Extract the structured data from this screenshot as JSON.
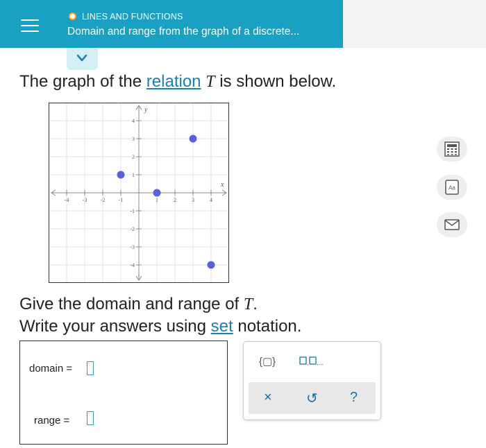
{
  "header": {
    "topic": "LINES AND FUNCTIONS",
    "subtitle": "Domain and range from the graph of a discrete...",
    "menu_icon": "hamburger-menu-icon",
    "expand_icon": "chevron-down-icon"
  },
  "prompt": {
    "before": "The graph of the ",
    "link": "relation",
    "var": "T",
    "after": " is shown below."
  },
  "graph": {
    "x_label": "x",
    "y_label": "y",
    "x_ticks": [
      "-4",
      "-3",
      "-2",
      "-1",
      "1",
      "2",
      "3",
      "4"
    ],
    "y_ticks": [
      "4",
      "3",
      "2",
      "1",
      "-1",
      "-2",
      "-3",
      "-4"
    ],
    "points": [
      {
        "x": -1,
        "y": 1
      },
      {
        "x": 1,
        "y": 0
      },
      {
        "x": 3,
        "y": 3
      },
      {
        "x": 4,
        "y": -4
      }
    ],
    "xlim": [
      -5,
      5
    ],
    "ylim": [
      -5,
      5
    ],
    "point_color": "#5a5fe0"
  },
  "question": {
    "line1_before": "Give the domain and range of ",
    "line1_var": "T",
    "line1_after": ".",
    "line2_before": "Write your answers using ",
    "line2_link": "set",
    "line2_after": " notation."
  },
  "answers": {
    "domain_label": "domain  =",
    "range_label": "range  ="
  },
  "tools": {
    "set_button": "{▢}",
    "list_button": "▢,▢,...",
    "clear": "×",
    "undo": "↺",
    "help": "?"
  },
  "side_icons": [
    "calculator-icon",
    "glossary-icon",
    "mail-icon"
  ],
  "side_glossary_text": "Aa",
  "colors": {
    "header": "#1aa0c3",
    "accent": "#1a7fb3",
    "topic_dot": "#f5a623"
  }
}
